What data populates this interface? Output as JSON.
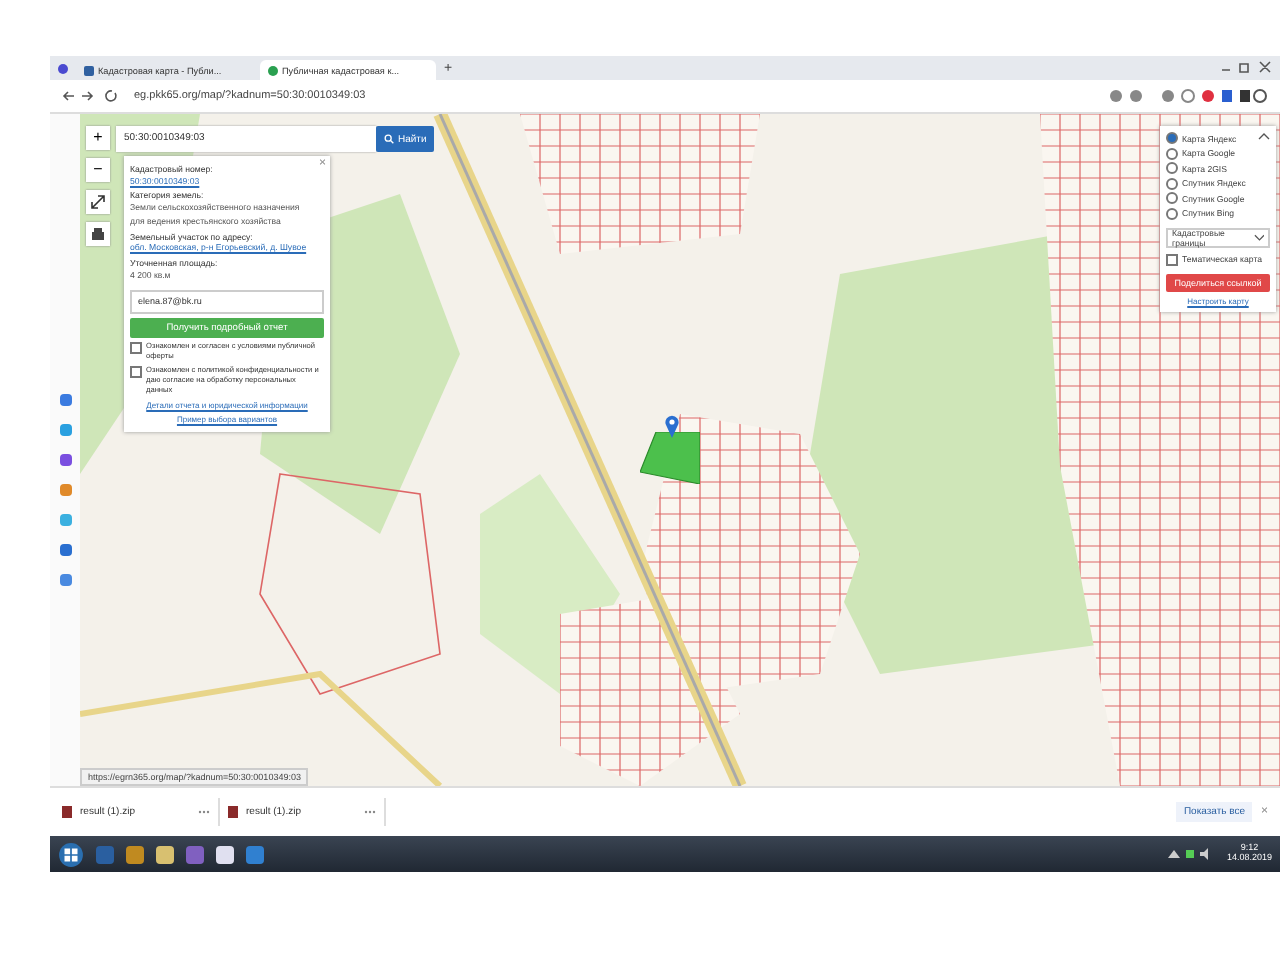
{
  "browser": {
    "tabs": [
      {
        "title": "Кадастровая карта - Публи...",
        "selected": false
      },
      {
        "title": "Публичная кадастровая к...",
        "selected": true
      }
    ],
    "new_tab": "+",
    "address": "eg.pkk65.org/map/?kadnum=50:30:0010349:03"
  },
  "map": {
    "zoom_in": "+",
    "zoom_out": "−",
    "search": {
      "value": "50:30:0010349:03",
      "button": "Найти"
    },
    "info_panel": {
      "close": "×",
      "fields": [
        {
          "label": "Кадастровый номер:",
          "value": "50:30:0010349:03",
          "kind": "link"
        },
        {
          "label": "Категория земель:",
          "value": "Земли сельскохозяйственного назначения",
          "kind": "plain"
        },
        {
          "value": "для ведения крестьянского хозяйства",
          "kind": "plain"
        },
        {
          "label": "Земельный участок по адресу:",
          "value": "обл. Московская, р-н Егорьевский, д. Шувое",
          "kind": "link"
        },
        {
          "label": "Уточненная площадь:",
          "value": "4 200 кв.м",
          "kind": "plain"
        }
      ],
      "email": {
        "value": "elena.87@bk.ru"
      },
      "report_button": "Получить подробный отчет",
      "agreements": [
        {
          "text": "Ознакомлен и согласен с условиями публичной оферты",
          "checked": false
        },
        {
          "text": "Ознакомлен с политикой конфиденциальности и даю согласие на обработку персональных данных",
          "checked": false
        }
      ],
      "links": [
        "Детали отчета и юридической информации",
        "Пример выбора вариантов"
      ]
    },
    "layers": {
      "options": [
        {
          "label": "Карта Яндекс",
          "selected": true
        },
        {
          "label": "Карта Google",
          "selected": false
        },
        {
          "label": "Карта 2GIS",
          "selected": false
        },
        {
          "label": "Спутник Яндекс",
          "selected": false
        },
        {
          "label": "Спутник Google",
          "selected": false
        },
        {
          "label": "Спутник Bing",
          "selected": false
        }
      ],
      "overlay_select": "Кадастровые границы",
      "thematic": {
        "label": "Тематическая карта",
        "checked": false
      },
      "share_button": "Поделиться ссылкой",
      "settings_link": "Настроить карту"
    },
    "status_url": "https://egrn365.org/map/?kadnum=50:30:0010349:03"
  },
  "downloads": {
    "items": [
      {
        "name": "result (1).zip"
      },
      {
        "name": "result (1).zip"
      }
    ],
    "show_all": "Показать все",
    "close": "×"
  },
  "taskbar": {
    "time": "9:12",
    "date": "14.08.2019"
  }
}
